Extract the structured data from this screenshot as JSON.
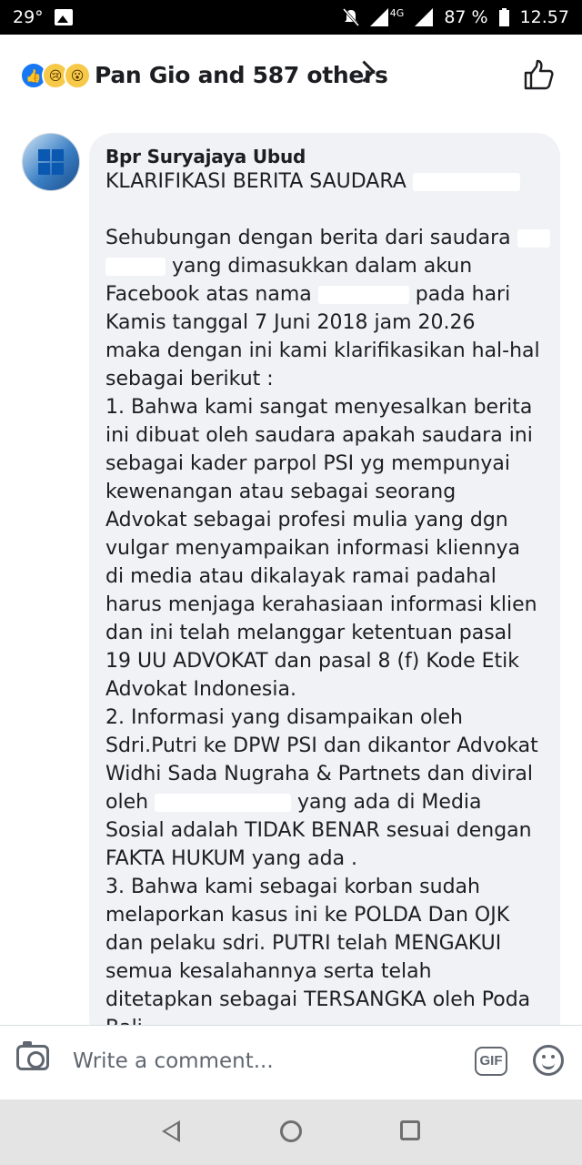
{
  "status_bar": {
    "temperature": "29°",
    "network": "4G",
    "battery": "87 %",
    "time": "12.57",
    "icons": [
      "image-icon",
      "mute-icon",
      "signal-icon",
      "battery-icon"
    ]
  },
  "reactions": {
    "summary": "Pan Gio and 587 others",
    "types": [
      "like",
      "sad",
      "wow"
    ]
  },
  "comment": {
    "author": "Bpr Suryajaya Ubud",
    "lines": [
      [
        "KLARIFIKASI BERITA  SAUDARA ",
        "[redacted]"
      ],
      [
        ""
      ],
      [
        "Sehubungan dengan berita dari saudara ",
        "[redacted]"
      ],
      [
        "[redacted]",
        " yang dimasukkan dalam akun"
      ],
      [
        "Facebook atas nama ",
        "[redacted]",
        "  pada hari"
      ],
      [
        "Kamis tanggal  7 Juni 2018 jam 20.26"
      ],
      [
        "maka dengan ini kami klarifikasikan hal-hal"
      ],
      [
        "sebagai berikut :"
      ],
      [
        "1. Bahwa kami sangat menyesalkan berita"
      ],
      [
        "ini dibuat oleh  saudara apakah saudara ini"
      ],
      [
        "sebagai  kader parpol PSI yg mempunyai"
      ],
      [
        "kewenangan  atau sebagai seorang"
      ],
      [
        "Advokat  sebagai profesi mulia yang dgn"
      ],
      [
        "vulgar  menyampaikan informasi  kliennya"
      ],
      [
        "di media atau dikalayak ramai  padahal"
      ],
      [
        "harus menjaga kerahasiaan informasi klien"
      ],
      [
        "dan ini telah  melanggar  ketentuan pasal"
      ],
      [
        "19 UU ADVOKAT dan  pasal 8 (f) Kode Etik"
      ],
      [
        "Advokat Indonesia."
      ],
      [
        "2. Informasi yang disampaikan oleh"
      ],
      [
        "Sdri.Putri ke DPW PSI dan dikantor Advokat"
      ],
      [
        "Widhi Sada Nugraha & Partnets dan diviral"
      ],
      [
        "oleh ",
        "[redacted]",
        "  yang ada di Media"
      ],
      [
        "Sosial adalah TIDAK BENAR  sesuai dengan"
      ],
      [
        "FAKTA HUKUM yang ada ."
      ],
      [
        "3. Bahwa  kami sebagai korban sudah"
      ],
      [
        "melaporkan kasus ini ke POLDA Dan OJK"
      ],
      [
        "dan  pelaku sdri. PUTRI telah MENGAKUI"
      ],
      [
        "semua kesalahannya serta  telah"
      ],
      [
        "ditetapkan sebagai TERSANGKA oleh Poda"
      ],
      [
        "Bali"
      ]
    ]
  },
  "composer": {
    "placeholder": "Write a comment...",
    "gif_label": "GIF"
  },
  "colors": {
    "bubble": "#f0f2f5",
    "text": "#1c1e21",
    "like_blue": "#1877f2",
    "navbar": "#e4e4e4"
  }
}
